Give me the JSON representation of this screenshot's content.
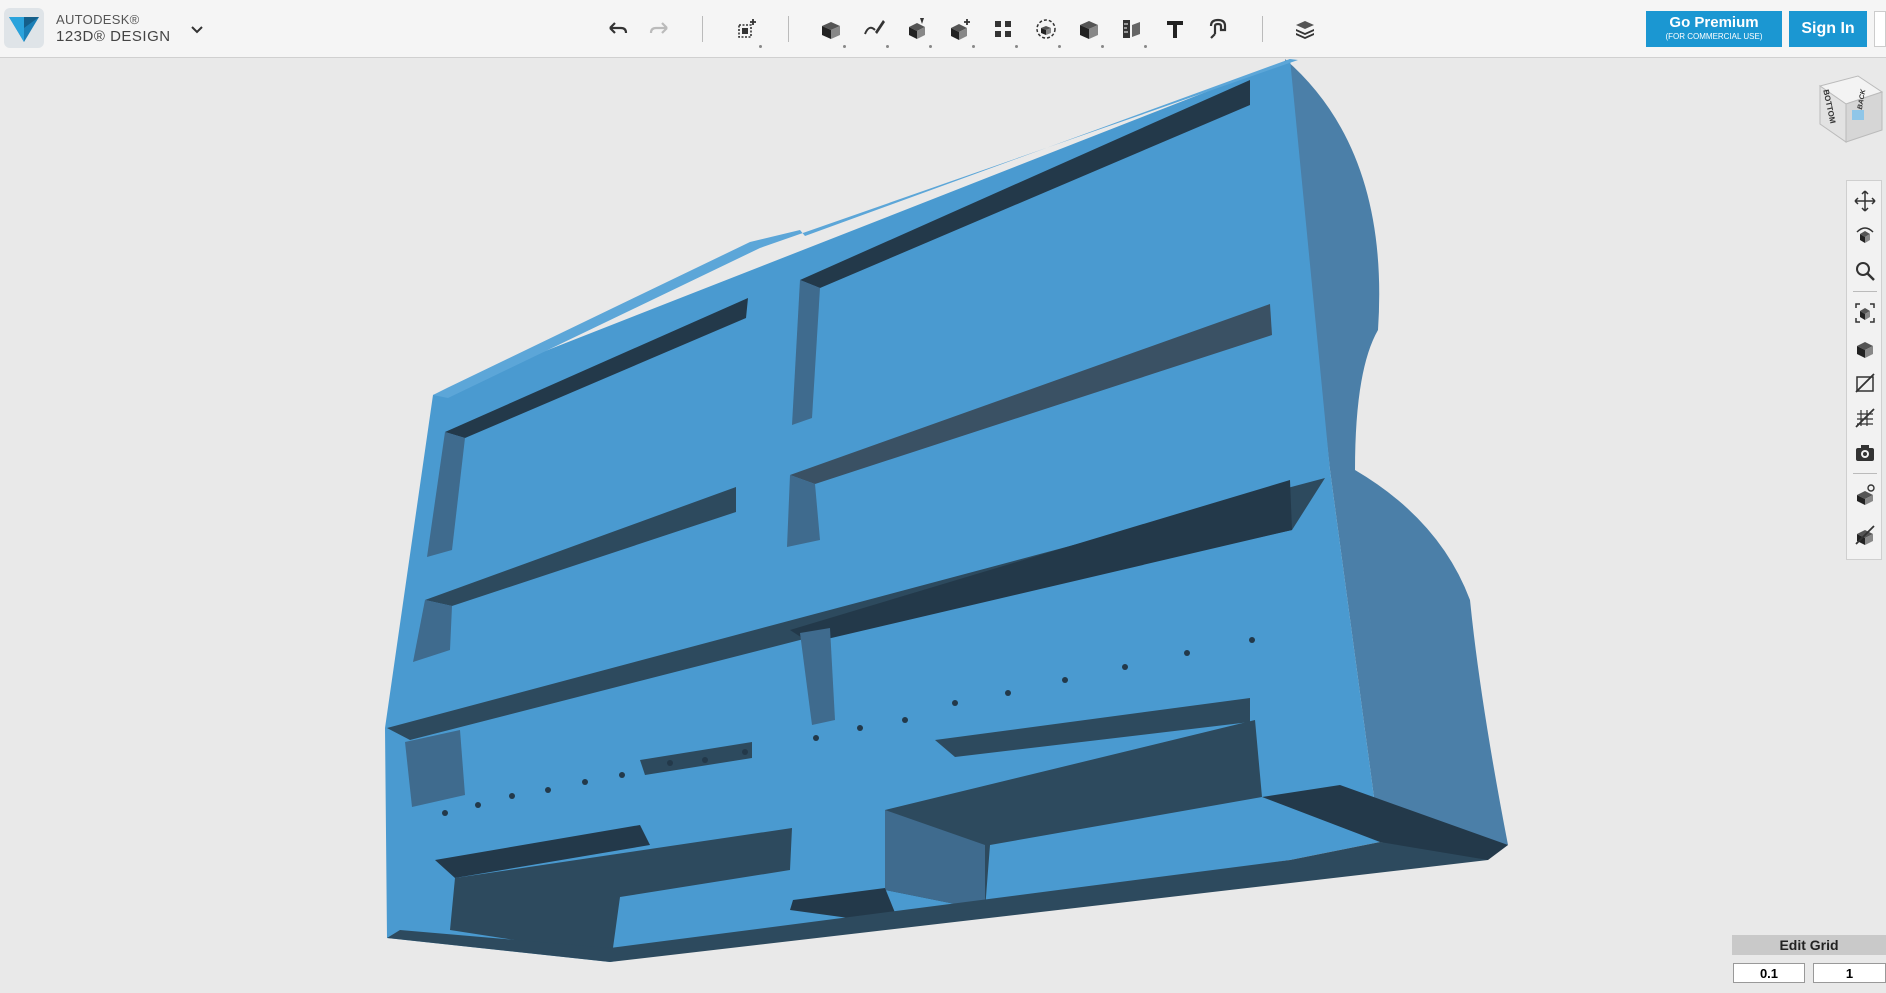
{
  "app": {
    "brand_line1": "AUTODESK®",
    "brand_line2": "123D® DESIGN"
  },
  "toolbar": {
    "tools": [
      {
        "name": "undo-button",
        "icon": "undo-icon"
      },
      {
        "name": "redo-button",
        "icon": "redo-icon"
      },
      {
        "name": "transform-button",
        "icon": "transform-icon"
      },
      {
        "name": "primitives-button",
        "icon": "primitive-box-icon"
      },
      {
        "name": "sketch-button",
        "icon": "sketch-pencil-icon"
      },
      {
        "name": "construct-button",
        "icon": "construct-icon"
      },
      {
        "name": "modify-button",
        "icon": "modify-icon"
      },
      {
        "name": "pattern-button",
        "icon": "pattern-icon"
      },
      {
        "name": "group-button",
        "icon": "group-icon"
      },
      {
        "name": "combine-button",
        "icon": "combine-icon"
      },
      {
        "name": "measure-button",
        "icon": "measure-icon"
      },
      {
        "name": "text-button",
        "icon": "text-icon"
      },
      {
        "name": "snap-button",
        "icon": "snap-magnet-icon"
      },
      {
        "name": "material-button",
        "icon": "material-layers-icon"
      }
    ]
  },
  "account": {
    "premium_label": "Go Premium",
    "premium_sub": "(FOR COMMERCIAL USE)",
    "signin_label": "Sign In"
  },
  "viewcube": {
    "face_bottom": "BOTTOM",
    "face_back": "BACK"
  },
  "nav": {
    "tools": [
      "pan-icon",
      "orbit-icon",
      "zoom-icon",
      "fit-icon",
      "view-icon",
      "hide-sketch-icon",
      "hide-mesh-icon",
      "camera-icon",
      "material-icon",
      "hide-solid-icon"
    ]
  },
  "grid": {
    "title": "Edit Grid",
    "snap_value": "0.1",
    "grid_value": "1"
  },
  "colors": {
    "model_face": "#4a9ad0",
    "model_dark": "#2d4a5e",
    "model_side": "#4b7fa8",
    "accent": "#1b97d2"
  }
}
